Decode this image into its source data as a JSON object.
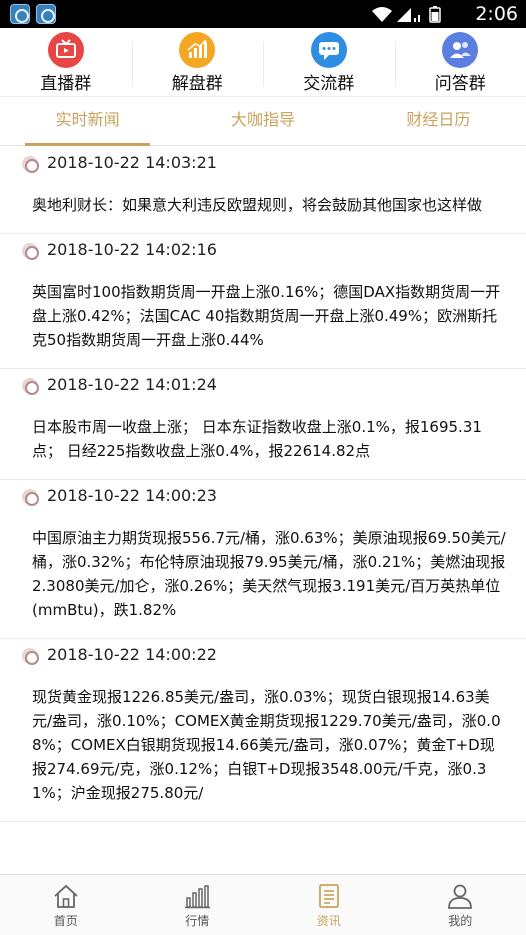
{
  "status_bar": {
    "time": "2:06",
    "icons": [
      "app-icon",
      "app-icon",
      "wifi-icon",
      "signal-icon",
      "battery-icon"
    ]
  },
  "groups": [
    {
      "label": "直播群",
      "icon": "tv-icon",
      "color": "#e84545"
    },
    {
      "label": "解盘群",
      "icon": "chart-icon",
      "color": "#f5a623"
    },
    {
      "label": "交流群",
      "icon": "chat-icon",
      "color": "#2f8de4"
    },
    {
      "label": "问答群",
      "icon": "people-icon",
      "color": "#5a7fe0"
    }
  ],
  "tabs": [
    {
      "label": "实时新闻",
      "active": true
    },
    {
      "label": "大咖指导",
      "active": false
    },
    {
      "label": "财经日历",
      "active": false
    }
  ],
  "accent_color": "#c9a35b",
  "news": [
    {
      "time": "2018-10-22 14:03:21",
      "text": "奥地利财长：如果意大利违反欧盟规则，将会鼓励其他国家也这样做"
    },
    {
      "time": "2018-10-22 14:02:16",
      "text": "英国富时100指数期货周一开盘上涨0.16%；德国DAX指数期货周一开盘上涨0.42%；法国CAC 40指数期货周一开盘上涨0.49%；欧洲斯托克50指数期货周一开盘上涨0.44%"
    },
    {
      "time": "2018-10-22 14:01:24",
      "text": "日本股市周一收盘上涨； 日本东证指数收盘上涨0.1%，报1695.31点； 日经225指数收盘上涨0.4%，报22614.82点"
    },
    {
      "time": "2018-10-22 14:00:23",
      "text": "中国原油主力期货现报556.7元/桶，涨0.63%；美原油现报69.50美元/桶，涨0.32%；布伦特原油现报79.95美元/桶，涨0.21%；美燃油现报2.3080美元/加仑，涨0.26%；美天然气现报3.191美元/百万英热单位(mmBtu)，跌1.82%"
    },
    {
      "time": "2018-10-22 14:00:22",
      "text": "现货黄金现报1226.85美元/盎司，涨0.03%；现货白银现报14.63美元/盎司，涨0.10%；COMEX黄金期货现报1229.70美元/盎司，涨0.08%；COMEX白银期货现报14.66美元/盎司，涨0.07%；黄金T+D现报274.69元/克，涨0.12%；白银T+D现报3548.00元/千克，涨0.31%；沪金现报275.80元/"
    }
  ],
  "bottom_nav": [
    {
      "label": "首页",
      "icon": "home-icon",
      "active": false
    },
    {
      "label": "行情",
      "icon": "bar-chart-icon",
      "active": false
    },
    {
      "label": "资讯",
      "icon": "document-icon",
      "active": true
    },
    {
      "label": "我的",
      "icon": "user-icon",
      "active": false
    }
  ]
}
